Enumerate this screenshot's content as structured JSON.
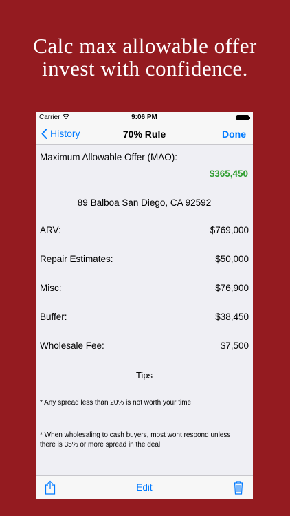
{
  "headline": {
    "line1": "Calc max allowable offer",
    "line2": "invest with confidence."
  },
  "status_bar": {
    "carrier": "Carrier",
    "time": "9:06 PM"
  },
  "nav": {
    "back_label": "History",
    "title": "70% Rule",
    "done_label": "Done"
  },
  "result": {
    "mao_label": "Maximum Allowable Offer (MAO):",
    "mao_value": "$365,450",
    "address": "89 Balboa San Diego, CA 92592"
  },
  "rows": [
    {
      "label": "ARV:",
      "value": "$769,000"
    },
    {
      "label": "Repair Estimates:",
      "value": "$50,000"
    },
    {
      "label": "Misc:",
      "value": "$76,900"
    },
    {
      "label": "Buffer:",
      "value": "$38,450"
    },
    {
      "label": "Wholesale Fee:",
      "value": "$7,500"
    }
  ],
  "tips": {
    "header": "Tips",
    "tip1": "* Any spread less than 20% is not worth your time.",
    "tip2": "* When wholesaling to cash buyers, most wont respond unless there is 35% or more spread in the deal."
  },
  "toolbar": {
    "edit_label": "Edit"
  },
  "icons": {
    "wifi": "wifi-icon",
    "battery": "battery-icon",
    "back": "chevron-left-icon",
    "share": "share-icon",
    "trash": "trash-icon"
  },
  "colors": {
    "background": "#941b20",
    "accent": "#007aff",
    "mao_value": "#2e9e2e",
    "tips_divider": "#8e3aa8"
  }
}
